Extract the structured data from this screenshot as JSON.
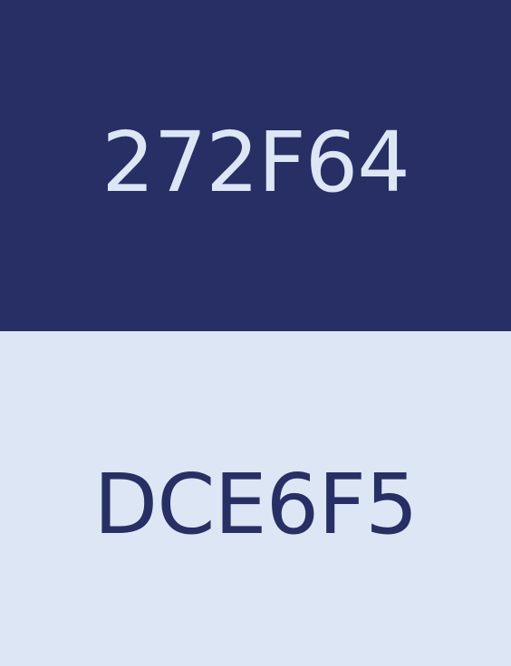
{
  "swatches": [
    {
      "label": "272F64",
      "background": "#272F64",
      "text_color": "#DCE6F5"
    },
    {
      "label": "DCE6F5",
      "background": "#DCE6F5",
      "text_color": "#272F64"
    }
  ]
}
